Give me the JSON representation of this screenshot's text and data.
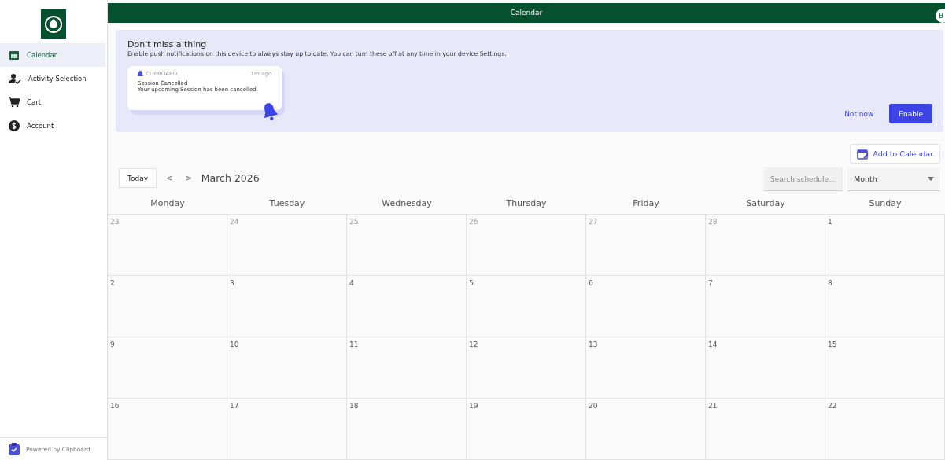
{
  "sidebar": {
    "items": [
      {
        "label": "Calendar",
        "selected": true
      },
      {
        "label": "Activity Selection",
        "selected": false
      },
      {
        "label": "Cart",
        "selected": false
      },
      {
        "label": "Account",
        "selected": false
      }
    ],
    "footer": "Powered by Clipboard"
  },
  "top_bar": {
    "title": "Calendar",
    "avatar": "B"
  },
  "banner": {
    "title": "Don't miss a thing",
    "text": "Enable push notifications on this device to always stay up to date. You can turn these off at any time in your device Settings.",
    "notification": {
      "app": "CLIPBOARD",
      "time": "1m ago",
      "title": "Session Cancelled",
      "body": "Your upcoming Session has been cancelled."
    },
    "buttons": [
      {
        "label": "Not now",
        "kind": "text"
      },
      {
        "label": "Enable",
        "kind": "primary"
      }
    ]
  },
  "toolbar": {
    "add_button": "Add to Calendar",
    "today": "Today",
    "prev": "<",
    "next": ">",
    "month": "March 2026",
    "search": {
      "placeholder": "Search schedule..."
    },
    "view": "Month"
  },
  "calendar": {
    "weekdays": [
      "Monday",
      "Tuesday",
      "Wednesday",
      "Thursday",
      "Friday",
      "Saturday",
      "Sunday"
    ],
    "weeks": [
      [
        {
          "day": "23",
          "outside": true
        },
        {
          "day": "24",
          "outside": true
        },
        {
          "day": "25",
          "outside": true
        },
        {
          "day": "26",
          "outside": true
        },
        {
          "day": "27",
          "outside": true
        },
        {
          "day": "28",
          "outside": true
        },
        {
          "day": "1",
          "outside": false
        }
      ],
      [
        {
          "day": "2",
          "outside": false
        },
        {
          "day": "3",
          "outside": false
        },
        {
          "day": "4",
          "outside": false
        },
        {
          "day": "5",
          "outside": false
        },
        {
          "day": "6",
          "outside": false
        },
        {
          "day": "7",
          "outside": false
        },
        {
          "day": "8",
          "outside": false
        }
      ],
      [
        {
          "day": "9",
          "outside": false
        },
        {
          "day": "10",
          "outside": false
        },
        {
          "day": "11",
          "outside": false
        },
        {
          "day": "12",
          "outside": false
        },
        {
          "day": "13",
          "outside": false
        },
        {
          "day": "14",
          "outside": false
        },
        {
          "day": "15",
          "outside": false
        }
      ],
      [
        {
          "day": "16",
          "outside": false
        },
        {
          "day": "17",
          "outside": false
        },
        {
          "day": "18",
          "outside": false
        },
        {
          "day": "19",
          "outside": false
        },
        {
          "day": "20",
          "outside": false
        },
        {
          "day": "21",
          "outside": false
        },
        {
          "day": "22",
          "outside": false
        }
      ]
    ]
  }
}
